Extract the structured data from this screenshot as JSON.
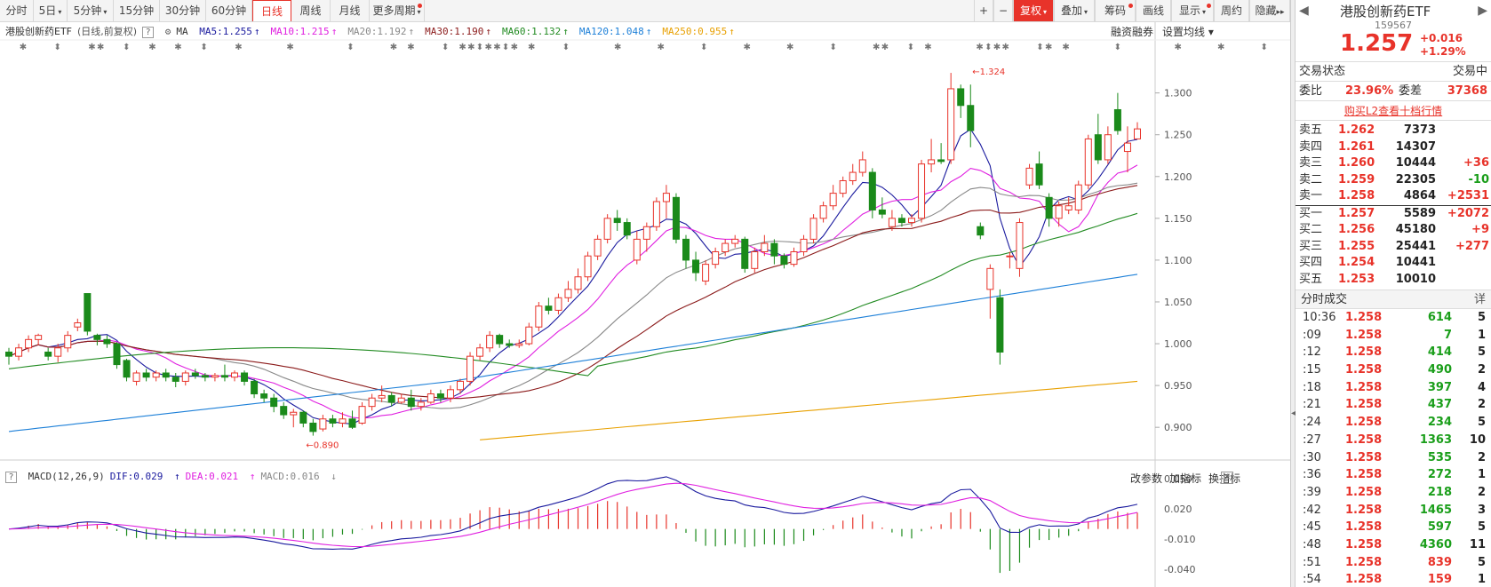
{
  "toolbar": {
    "left_tabs": [
      "分时",
      "5日",
      "5分钟",
      "15分钟",
      "30分钟",
      "60分钟",
      "日线",
      "周线",
      "月线",
      "更多周期"
    ],
    "active_tab": "日线",
    "right_buttons": [
      "+",
      "−",
      "复权",
      "叠加",
      "筹码",
      "画线",
      "显示",
      "周约",
      "隐藏"
    ]
  },
  "legend": {
    "title": "港股创新药ETF",
    "subtitle": "(日线,前复权)",
    "ma_label": "MA",
    "items": [
      {
        "text": "MA5:1.255",
        "arrow": "↑",
        "color": "#1a1a9e"
      },
      {
        "text": "MA10:1.215",
        "arrow": "↑",
        "color": "#e020e0"
      },
      {
        "text": "MA20:1.192",
        "arrow": "↑",
        "color": "#888888"
      },
      {
        "text": "MA30:1.190",
        "arrow": "↑",
        "color": "#8b1a1a"
      },
      {
        "text": "MA60:1.132",
        "arrow": "↑",
        "color": "#228b22"
      },
      {
        "text": "MA120:1.048",
        "arrow": "↑",
        "color": "#1e80d8"
      },
      {
        "text": "MA250:0.955",
        "arrow": "↑",
        "color": "#e8a000"
      }
    ],
    "right_buttons": [
      "融资融券",
      "设置均线"
    ]
  },
  "macd": {
    "label": "MACD(12,26,9)",
    "dif": "DIF:0.029",
    "dea": "DEA:0.021",
    "macd": "MACD:0.016",
    "buttons": [
      "改参数",
      "加指标",
      "换指标"
    ],
    "y_ticks": [
      "0.050",
      "0.020",
      "-0.010",
      "-0.040"
    ]
  },
  "price_axis": [
    "1.300",
    "1.250",
    "1.200",
    "1.150",
    "1.100",
    "1.050",
    "1.000",
    "0.950",
    "0.900"
  ],
  "annotations": {
    "high": "1.324",
    "low": "0.890"
  },
  "chart_data": {
    "type": "candlestick",
    "ylim": [
      0.88,
      1.34
    ],
    "high_label": 1.324,
    "low_label": 0.89,
    "candles": [
      [
        0.99,
        0.985,
        0.995,
        0.975
      ],
      [
        0.985,
        0.995,
        1.0,
        0.98
      ],
      [
        0.995,
        1.005,
        1.01,
        0.99
      ],
      [
        1.005,
        1.01,
        1.012,
        0.998
      ],
      [
        0.99,
        0.985,
        0.995,
        0.98
      ],
      [
        0.985,
        0.995,
        1.0,
        0.978
      ],
      [
        0.995,
        1.01,
        1.015,
        0.99
      ],
      [
        1.02,
        1.025,
        1.03,
        1.015
      ],
      [
        1.06,
        1.015,
        1.06,
        1.01
      ],
      [
        1.01,
        1.005,
        1.012,
        0.998
      ],
      [
        1.005,
        1.0,
        1.01,
        0.995
      ],
      [
        1.0,
        0.975,
        1.002,
        0.97
      ],
      [
        0.98,
        0.96,
        0.982,
        0.955
      ],
      [
        0.955,
        0.965,
        0.968,
        0.95
      ],
      [
        0.965,
        0.96,
        0.97,
        0.955
      ],
      [
        0.96,
        0.965,
        0.968,
        0.955
      ],
      [
        0.965,
        0.96,
        0.97,
        0.955
      ],
      [
        0.96,
        0.955,
        0.965,
        0.948
      ],
      [
        0.955,
        0.965,
        0.968,
        0.95
      ],
      [
        0.965,
        0.962,
        0.97,
        0.958
      ],
      [
        0.962,
        0.96,
        0.965,
        0.955
      ],
      [
        0.96,
        0.962,
        0.965,
        0.955
      ],
      [
        0.962,
        0.96,
        0.975,
        0.955
      ],
      [
        0.96,
        0.965,
        0.968,
        0.955
      ],
      [
        0.965,
        0.955,
        0.968,
        0.95
      ],
      [
        0.955,
        0.94,
        0.958,
        0.935
      ],
      [
        0.94,
        0.935,
        0.945,
        0.93
      ],
      [
        0.935,
        0.925,
        0.94,
        0.918
      ],
      [
        0.925,
        0.915,
        0.93,
        0.91
      ],
      [
        0.915,
        0.918,
        0.922,
        0.9
      ],
      [
        0.918,
        0.905,
        0.92,
        0.9
      ],
      [
        0.905,
        0.895,
        0.91,
        0.89
      ],
      [
        0.898,
        0.91,
        0.915,
        0.895
      ],
      [
        0.91,
        0.905,
        0.915,
        0.9
      ],
      [
        0.905,
        0.91,
        0.918,
        0.9
      ],
      [
        0.91,
        0.9,
        0.92,
        0.898
      ],
      [
        0.905,
        0.925,
        0.93,
        0.903
      ],
      [
        0.925,
        0.935,
        0.94,
        0.92
      ],
      [
        0.935,
        0.938,
        0.95,
        0.93
      ],
      [
        0.938,
        0.93,
        0.942,
        0.925
      ],
      [
        0.93,
        0.935,
        0.94,
        0.928
      ],
      [
        0.935,
        0.925,
        0.945,
        0.92
      ],
      [
        0.925,
        0.93,
        0.935,
        0.92
      ],
      [
        0.93,
        0.94,
        0.945,
        0.928
      ],
      [
        0.94,
        0.935,
        0.945,
        0.93
      ],
      [
        0.935,
        0.945,
        0.95,
        0.93
      ],
      [
        0.945,
        0.955,
        0.958,
        0.94
      ],
      [
        0.955,
        0.985,
        0.99,
        0.95
      ],
      [
        0.985,
        0.995,
        1.0,
        0.98
      ],
      [
        0.995,
        1.01,
        1.015,
        0.99
      ],
      [
        1.01,
        1.0,
        1.012,
        0.995
      ],
      [
        1.0,
        0.998,
        1.005,
        0.995
      ],
      [
        0.998,
        1.0,
        1.005,
        0.995
      ],
      [
        1.0,
        1.02,
        1.025,
        0.998
      ],
      [
        1.02,
        1.045,
        1.05,
        1.015
      ],
      [
        1.045,
        1.04,
        1.055,
        1.035
      ],
      [
        1.04,
        1.055,
        1.06,
        1.035
      ],
      [
        1.055,
        1.065,
        1.075,
        1.05
      ],
      [
        1.065,
        1.08,
        1.09,
        1.06
      ],
      [
        1.08,
        1.105,
        1.11,
        1.075
      ],
      [
        1.105,
        1.125,
        1.13,
        1.1
      ],
      [
        1.125,
        1.15,
        1.155,
        1.12
      ],
      [
        1.15,
        1.145,
        1.16,
        1.135
      ],
      [
        1.145,
        1.13,
        1.15,
        1.125
      ],
      [
        1.1,
        1.125,
        1.135,
        1.095
      ],
      [
        1.125,
        1.14,
        1.145,
        1.11
      ],
      [
        1.14,
        1.17,
        1.175,
        1.135
      ],
      [
        1.17,
        1.18,
        1.19,
        1.15
      ],
      [
        1.175,
        1.125,
        1.18,
        1.12
      ],
      [
        1.125,
        1.1,
        1.13,
        1.09
      ],
      [
        1.1,
        1.085,
        1.11,
        1.075
      ],
      [
        1.075,
        1.095,
        1.1,
        1.07
      ],
      [
        1.095,
        1.11,
        1.115,
        1.09
      ],
      [
        1.11,
        1.12,
        1.125,
        1.105
      ],
      [
        1.12,
        1.125,
        1.13,
        1.115
      ],
      [
        1.125,
        1.09,
        1.128,
        1.085
      ],
      [
        1.09,
        1.11,
        1.115,
        1.085
      ],
      [
        1.11,
        1.12,
        1.13,
        1.105
      ],
      [
        1.12,
        1.105,
        1.125,
        1.095
      ],
      [
        1.105,
        1.095,
        1.108,
        1.09
      ],
      [
        1.095,
        1.11,
        1.115,
        1.092
      ],
      [
        1.11,
        1.125,
        1.13,
        1.105
      ],
      [
        1.125,
        1.15,
        1.155,
        1.12
      ],
      [
        1.15,
        1.165,
        1.17,
        1.145
      ],
      [
        1.165,
        1.18,
        1.19,
        1.16
      ],
      [
        1.18,
        1.195,
        1.2,
        1.175
      ],
      [
        1.195,
        1.205,
        1.215,
        1.19
      ],
      [
        1.205,
        1.22,
        1.23,
        1.2
      ],
      [
        1.205,
        1.16,
        1.21,
        1.15
      ],
      [
        1.16,
        1.155,
        1.175,
        1.15
      ],
      [
        1.14,
        1.15,
        1.16,
        1.135
      ],
      [
        1.15,
        1.145,
        1.155,
        1.14
      ],
      [
        1.145,
        1.15,
        1.155,
        1.14
      ],
      [
        1.15,
        1.215,
        1.22,
        1.145
      ],
      [
        1.215,
        1.22,
        1.245,
        1.205
      ],
      [
        1.22,
        1.218,
        1.24,
        1.215
      ],
      [
        1.22,
        1.305,
        1.324,
        1.215
      ],
      [
        1.305,
        1.285,
        1.31,
        1.27
      ],
      [
        1.285,
        1.255,
        1.31,
        1.235
      ],
      [
        1.14,
        1.13,
        1.145,
        1.125
      ],
      [
        1.065,
        1.09,
        1.095,
        1.03
      ],
      [
        1.055,
        0.99,
        1.065,
        0.975
      ],
      [
        1.105,
        1.105,
        1.11,
        1.09
      ],
      [
        1.09,
        1.145,
        1.15,
        1.08
      ],
      [
        1.19,
        1.21,
        1.215,
        1.185
      ],
      [
        1.215,
        1.19,
        1.23,
        1.185
      ],
      [
        1.175,
        1.15,
        1.18,
        1.14
      ],
      [
        1.15,
        1.165,
        1.17,
        1.14
      ],
      [
        1.16,
        1.165,
        1.175,
        1.155
      ],
      [
        1.16,
        1.19,
        1.195,
        1.155
      ],
      [
        1.19,
        1.245,
        1.25,
        1.185
      ],
      [
        1.25,
        1.22,
        1.275,
        1.215
      ],
      [
        1.22,
        1.25,
        1.26,
        1.215
      ],
      [
        1.28,
        1.255,
        1.3,
        1.25
      ],
      [
        1.23,
        1.24,
        1.26,
        1.205
      ],
      [
        1.245,
        1.257,
        1.265,
        1.245
      ]
    ],
    "ma_series": [
      {
        "name": "MA5",
        "color": "#1a1a9e"
      },
      {
        "name": "MA10",
        "color": "#e020e0"
      },
      {
        "name": "MA20",
        "color": "#888888"
      },
      {
        "name": "MA30",
        "color": "#8b1a1a"
      },
      {
        "name": "MA60",
        "color": "#228b22"
      },
      {
        "name": "MA120",
        "color": "#1e80d8"
      },
      {
        "name": "MA250",
        "color": "#e8a000"
      }
    ],
    "macd_ylim": [
      -0.048,
      0.058
    ]
  },
  "right_panel": {
    "name": "港股创新药ETF",
    "code": "159567",
    "price": "1.257",
    "change": "+0.016",
    "change_pct": "+1.29%",
    "status_label": "交易状态",
    "status_value": "交易中",
    "weibi_label": "委比",
    "weibi_value": "23.96%",
    "weicha_label": "委差",
    "weicha_value": "37368",
    "l2_link": "购买L2查看十档行情",
    "asks": [
      {
        "label": "卖五",
        "price": "1.262",
        "vol": "7373",
        "chg": ""
      },
      {
        "label": "卖四",
        "price": "1.261",
        "vol": "14307",
        "chg": ""
      },
      {
        "label": "卖三",
        "price": "1.260",
        "vol": "10444",
        "chg": "+36"
      },
      {
        "label": "卖二",
        "price": "1.259",
        "vol": "22305",
        "chg": "-10"
      },
      {
        "label": "卖一",
        "price": "1.258",
        "vol": "4864",
        "chg": "+2531"
      }
    ],
    "bids": [
      {
        "label": "买一",
        "price": "1.257",
        "vol": "5589",
        "chg": "+2072"
      },
      {
        "label": "买二",
        "price": "1.256",
        "vol": "45180",
        "chg": "+9"
      },
      {
        "label": "买三",
        "price": "1.255",
        "vol": "25441",
        "chg": "+277"
      },
      {
        "label": "买四",
        "price": "1.254",
        "vol": "10441",
        "chg": ""
      },
      {
        "label": "买五",
        "price": "1.253",
        "vol": "10010",
        "chg": ""
      }
    ],
    "ticks_title": "分时成交",
    "ticks_detail": "详",
    "ticks": [
      {
        "t": "10:36",
        "p": "1.258",
        "v": "614",
        "n": "5",
        "c": "#1a9e1a"
      },
      {
        "t": ":09",
        "p": "1.258",
        "v": "7",
        "n": "1",
        "c": "#1a9e1a"
      },
      {
        "t": ":12",
        "p": "1.258",
        "v": "414",
        "n": "5",
        "c": "#1a9e1a"
      },
      {
        "t": ":15",
        "p": "1.258",
        "v": "490",
        "n": "2",
        "c": "#1a9e1a"
      },
      {
        "t": ":18",
        "p": "1.258",
        "v": "397",
        "n": "4",
        "c": "#1a9e1a"
      },
      {
        "t": ":21",
        "p": "1.258",
        "v": "437",
        "n": "2",
        "c": "#1a9e1a"
      },
      {
        "t": ":24",
        "p": "1.258",
        "v": "234",
        "n": "5",
        "c": "#1a9e1a"
      },
      {
        "t": ":27",
        "p": "1.258",
        "v": "1363",
        "n": "10",
        "c": "#1a9e1a"
      },
      {
        "t": ":30",
        "p": "1.258",
        "v": "535",
        "n": "2",
        "c": "#1a9e1a"
      },
      {
        "t": ":36",
        "p": "1.258",
        "v": "272",
        "n": "1",
        "c": "#1a9e1a"
      },
      {
        "t": ":39",
        "p": "1.258",
        "v": "218",
        "n": "2",
        "c": "#1a9e1a"
      },
      {
        "t": ":42",
        "p": "1.258",
        "v": "1465",
        "n": "3",
        "c": "#1a9e1a"
      },
      {
        "t": ":45",
        "p": "1.258",
        "v": "597",
        "n": "5",
        "c": "#1a9e1a"
      },
      {
        "t": ":48",
        "p": "1.258",
        "v": "4360",
        "n": "11",
        "c": "#1a9e1a"
      },
      {
        "t": ":51",
        "p": "1.258",
        "v": "839",
        "n": "5",
        "c": "#e8332a"
      },
      {
        "t": ":54",
        "p": "1.258",
        "v": "159",
        "n": "1",
        "c": "#e8332a"
      }
    ]
  }
}
